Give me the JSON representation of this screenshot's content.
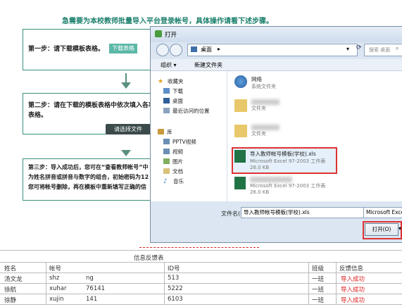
{
  "page": {
    "headline": "急需要为本校教师批量导入平台登录帐号，具体操作请看下述步骤。",
    "step1": {
      "text": "第一步：请下载模板表格。",
      "button": "下载表格"
    },
    "step2": {
      "text_line1": "第二步：请在下载的模板表格中依次填入各项数",
      "text_line2": "表格。",
      "choose_button": "请选择文件"
    },
    "step3": {
      "line1": "第三步：导入成功后，您可在“查看教师帐号”中",
      "line2": "为姓名拼音或拼音与数字的组合，初始密码为12",
      "line3": "您可将帐号删除，再在模板中重新填写正确的信"
    }
  },
  "dialog": {
    "title": "打开",
    "address": "桌面",
    "search_placeholder": "搜索 桌面",
    "toolbar": {
      "organize": "组织 ▾",
      "new_folder": "新建文件夹"
    },
    "nav": {
      "favorites": "收藏夹",
      "downloads": "下载",
      "desktop": "桌面",
      "recent": "最近访问的位置",
      "libraries": "库",
      "pptv": "PPTV视频",
      "video": "视频",
      "pictures": "图片",
      "documents": "文档",
      "music": "音乐"
    },
    "files": [
      {
        "name": "网络",
        "sub": "系统文件夹"
      },
      {
        "name": "",
        "sub": "文件夹"
      },
      {
        "name": "",
        "sub": "文件夹"
      },
      {
        "name": "导入教师帐号模板(学校).xls",
        "sub": "Microsoft Excel 97-2003 工作表",
        "size": "26.0 KB"
      },
      {
        "name": "",
        "sub": "Microsoft Excel 97-2003 工作表",
        "size": "26.0 KB"
      }
    ],
    "filename_label": "文件名(N):",
    "filename_value": "导入教师帐号模板(学校).xls",
    "filetype_value": "Microsoft Excel",
    "open_button": "打开(O)"
  },
  "table": {
    "title": "信息反馈表",
    "headers": [
      "姓名",
      "帐号",
      "ID号",
      "班级",
      "反馈信息"
    ],
    "rows": [
      {
        "name": "汤文龙",
        "account": "shz",
        "account_tail": "ng",
        "id": "513",
        "class": "一班",
        "status": "导入成功"
      },
      {
        "name": "徐航",
        "account": "xuhar",
        "account_tail": "76141",
        "id": "5222",
        "class": "一班",
        "status": "导入成功"
      },
      {
        "name": "徐静",
        "account": "xujin",
        "account_tail": "141",
        "id": "6103",
        "class": "一班",
        "status": "导入成功"
      }
    ]
  },
  "colors": {
    "accent": "#3a8f7d",
    "status_red": "#d22222",
    "highlight": "#d33333"
  }
}
